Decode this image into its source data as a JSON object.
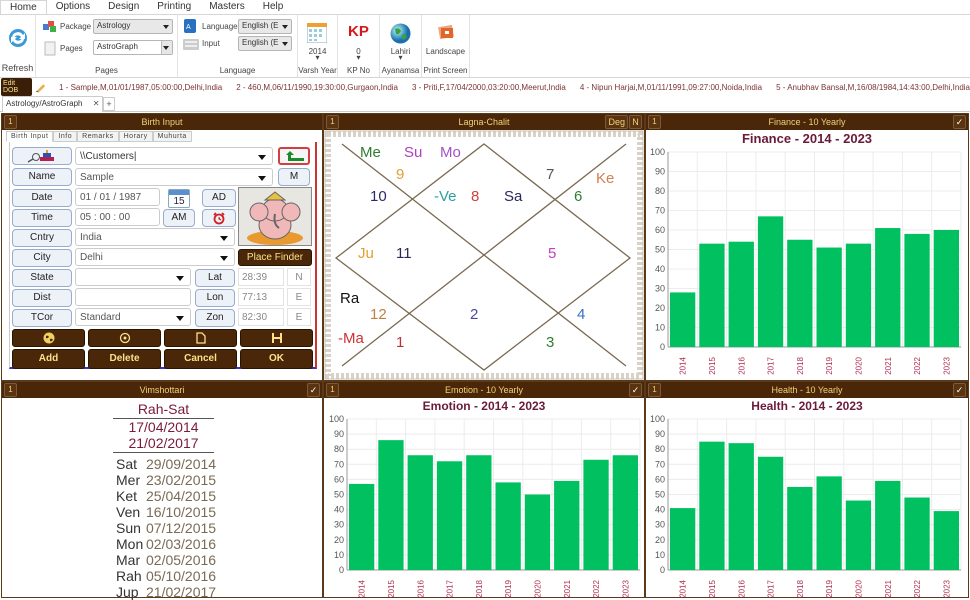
{
  "menu": {
    "items": [
      "Home",
      "Options",
      "Design",
      "Printing",
      "Masters",
      "Help"
    ],
    "active": "Home"
  },
  "ribbon": {
    "refresh_label": "Refresh",
    "pages_group": {
      "package_label": "Package",
      "package_value": "Astrology",
      "pages_label": "Pages",
      "pages_value": "AstroGraph",
      "group_label": "Pages"
    },
    "language_group": {
      "language_label": "Language",
      "language_value": "English (E",
      "input_label": "Input",
      "input_value": "English (E",
      "group_label": "Language"
    },
    "varsh_year": {
      "value": "2014",
      "label": "Varsh Year"
    },
    "kp_no": {
      "icon_text": "KP",
      "value": "0",
      "label": "KP No"
    },
    "ayanamsa": {
      "value": "Lahiri",
      "label": "Ayanamsa"
    },
    "print_screen": {
      "value": "Landscape",
      "label": "Print Screen"
    }
  },
  "dob_bar": {
    "edit_label": "Edit DOB",
    "items": [
      "1 - Sample,M,01/01/1987,05:00:00,Delhi,India",
      "2 - 460,M,06/11/1990,19:30:00,Gurgaon,India",
      "3 - Priti,F,17/04/2000,03:20:00,Meerut,India",
      "4 - Nipun Harjai,M,01/11/1991,09:27:00,Noida,India",
      "5 - Anubhav Bansal,M,16/08/1984,14:43:00,Delhi,India"
    ]
  },
  "doc_tab": {
    "label": "Astrology/AstroGraph",
    "close": "✕",
    "add": "+"
  },
  "birth_input": {
    "num": "1",
    "title": "Birth Input",
    "tabs": [
      "Birth Input",
      "Info",
      "Remarks",
      "Horary",
      "Muhurta"
    ],
    "folder_value": "\\\\Customers",
    "name_label": "Name",
    "name_value": "Sample",
    "m_label": "M",
    "date_label": "Date",
    "date_value": "01 / 01 / 1987",
    "cal_num": "15",
    "ad_label": "AD",
    "time_label": "Time",
    "time_value": "05 :  00  :  00",
    "am_label": "AM",
    "country_label": "Cntry",
    "country_value": "India",
    "city_label": "City",
    "city_value": "Delhi",
    "place_finder": "Place Finder",
    "state_label": "State",
    "state_value": "",
    "lat_label": "Lat",
    "lat_value": "28:39",
    "lat_dir": "N",
    "dist_label": "Dist",
    "dist_value": "",
    "lon_label": "Lon",
    "lon_value": "77:13",
    "lon_dir": "E",
    "tcor_label": "TCor",
    "tcor_value": "Standard",
    "zon_label": "Zon",
    "zon_value": "82:30",
    "zon_dir": "E",
    "buttons": [
      "Add",
      "Delete",
      "Cancel",
      "OK"
    ]
  },
  "lagna": {
    "num": "1",
    "title": "Lagna-Chalit",
    "deg": "Deg",
    "n": "N",
    "houses": [
      {
        "text": "Me",
        "color": "#2e7d32"
      },
      {
        "text": "Su",
        "color": "#b040c0"
      },
      {
        "text": "Mo",
        "color": "#a050d0"
      },
      {
        "text": "9",
        "color": "#e0a030"
      },
      {
        "text": "10",
        "color": "#2a2a6a"
      },
      {
        "text": "-Ve",
        "color": "#2aa0a0"
      },
      {
        "text": "8",
        "color": "#d04040"
      },
      {
        "text": "Sa",
        "color": "#2a2a5a"
      },
      {
        "text": "7",
        "color": "#555"
      },
      {
        "text": "Ke",
        "color": "#d08050"
      },
      {
        "text": "6",
        "color": "#2e7d32"
      },
      {
        "text": "Ju",
        "color": "#e0a030"
      },
      {
        "text": "11",
        "color": "#2a2a5a"
      },
      {
        "text": "5",
        "color": "#c040c0"
      },
      {
        "text": "Ra",
        "color": "#111"
      },
      {
        "text": "12",
        "color": "#c08040"
      },
      {
        "text": "2",
        "color": "#4a4aa0"
      },
      {
        "text": "4",
        "color": "#3a70c0"
      },
      {
        "text": "-Ma",
        "color": "#d03030"
      },
      {
        "text": "1",
        "color": "#c03030"
      },
      {
        "text": "3",
        "color": "#2e7d32"
      }
    ]
  },
  "vimshottari": {
    "num": "1",
    "title": "Vimshottari",
    "period": "Rah-Sat",
    "start": "17/04/2014",
    "end": "21/02/2017",
    "rows": [
      {
        "planet": "Sat",
        "date": "29/09/2014"
      },
      {
        "planet": "Mer",
        "date": "23/02/2015"
      },
      {
        "planet": "Ket",
        "date": "25/04/2015"
      },
      {
        "planet": "Ven",
        "date": "16/10/2015"
      },
      {
        "planet": "Sun",
        "date": "07/12/2015"
      },
      {
        "planet": "Mon",
        "date": "02/03/2016"
      },
      {
        "planet": "Mar",
        "date": "02/05/2016"
      },
      {
        "planet": "Rah",
        "date": "05/10/2016"
      },
      {
        "planet": "Jup",
        "date": "21/02/2017"
      }
    ]
  },
  "panels": {
    "finance": {
      "num": "1",
      "header": "Finance - 10 Yearly"
    },
    "emotion": {
      "num": "1",
      "header": "Emotion - 10 Yearly"
    },
    "health": {
      "num": "1",
      "header": "Health - 10 Yearly"
    }
  },
  "chart_data": [
    {
      "type": "bar",
      "title": "Finance - 2014 - 2023",
      "categories": [
        "2014",
        "2015",
        "2016",
        "2017",
        "2018",
        "2019",
        "2020",
        "2021",
        "2022",
        "2023"
      ],
      "values": [
        28,
        53,
        54,
        67,
        55,
        51,
        53,
        61,
        58,
        60
      ],
      "ylim": [
        0,
        100
      ],
      "yticks": [
        0,
        10,
        20,
        30,
        40,
        50,
        60,
        70,
        80,
        90,
        100
      ],
      "grid": true,
      "color": "#00c060"
    },
    {
      "type": "bar",
      "title": "Emotion - 2014 - 2023",
      "categories": [
        "2014",
        "2015",
        "2016",
        "2017",
        "2018",
        "2019",
        "2020",
        "2021",
        "2022",
        "2023"
      ],
      "values": [
        57,
        86,
        76,
        72,
        76,
        58,
        50,
        59,
        73,
        76
      ],
      "ylim": [
        0,
        100
      ],
      "yticks": [
        0,
        10,
        20,
        30,
        40,
        50,
        60,
        70,
        80,
        90,
        100
      ],
      "grid": true,
      "color": "#00c060"
    },
    {
      "type": "bar",
      "title": "Health - 2014 - 2023",
      "categories": [
        "2014",
        "2015",
        "2016",
        "2017",
        "2018",
        "2019",
        "2020",
        "2021",
        "2022",
        "2023"
      ],
      "values": [
        41,
        85,
        84,
        75,
        55,
        62,
        46,
        59,
        48,
        39
      ],
      "ylim": [
        0,
        100
      ],
      "yticks": [
        0,
        10,
        20,
        30,
        40,
        50,
        60,
        70,
        80,
        90,
        100
      ],
      "grid": true,
      "color": "#00c060"
    }
  ]
}
